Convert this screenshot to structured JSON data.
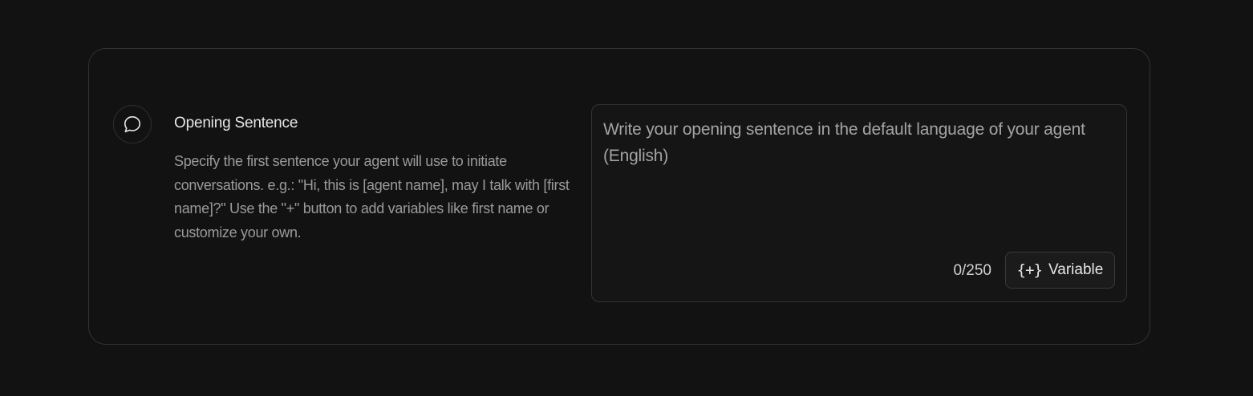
{
  "section": {
    "icon": "chat-bubble-icon",
    "title": "Opening Sentence",
    "description": "Specify the first sentence your agent will use to initiate conversations. e.g.: \"Hi, this is [agent name], may I talk with [first name]?\" Use the \"+\" button to add variables like first name or customize your own."
  },
  "editor": {
    "value": "",
    "placeholder": "Write your opening sentence in the default language of your agent (English)",
    "char_count": "0/250",
    "variable_button": {
      "icon": "add-variable-icon",
      "icon_glyph": "{+}",
      "label": "Variable"
    }
  },
  "colors": {
    "background": "#121212",
    "border": "#333333",
    "text_primary": "#e6e6e6",
    "text_secondary": "#9a9a9a"
  }
}
